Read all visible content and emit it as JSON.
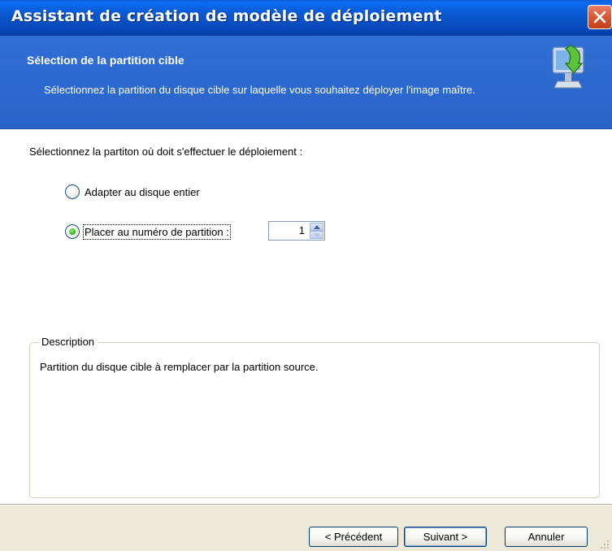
{
  "window": {
    "title": "Assistant de création de modèle de déploiement"
  },
  "header": {
    "title": "Sélection de la partition cible",
    "description": "Sélectionnez la partition du disque cible sur laquelle vous souhaitez déployer l'image maître.",
    "icon": "monitor-download-icon"
  },
  "content": {
    "prompt": "Sélectionnez la partiton où doit s'effectuer le déploiement :",
    "options": [
      {
        "label": "Adapter au disque entier",
        "checked": false
      },
      {
        "label": "Placer au numéro de partition :",
        "checked": true
      }
    ],
    "partition_number": "1"
  },
  "description": {
    "legend": "Description",
    "text": "Partition du disque cible à remplacer par la partition source."
  },
  "buttons": {
    "previous": "< Précédent",
    "next": "Suivant >",
    "cancel": "Annuler"
  },
  "colors": {
    "titlebar": "#0a58d0",
    "header_bg": "#2f6fd6",
    "close_button": "#d85a36",
    "radio_checked": "#36b81c"
  }
}
